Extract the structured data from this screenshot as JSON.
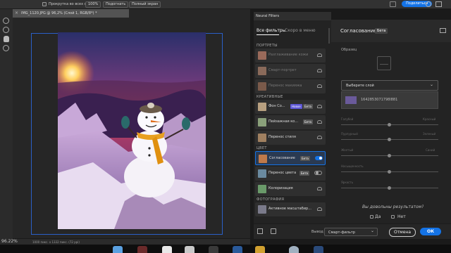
{
  "options_bar": {
    "scroll_all_label": "Прокрутка во всех окнах",
    "zoom_value": "100%",
    "fit_button": "Подогнать",
    "fullscreen_button": "Полный экран",
    "share_button": "Поделиться"
  },
  "document": {
    "tab_title": "IMG_1120.JPG @ 96,2% (Слой 1, RGB/8*) *",
    "zoom": "96.22%",
    "status": "1000 пикс. x 1332 пикс. (72 ppi)"
  },
  "neural_filters": {
    "panel_title": "Neural Filters",
    "tab_all": "Все фильтры",
    "tab_soon": "Скоро в меню",
    "sections": {
      "portraits": "ПОРТРЕТЫ",
      "creative": "КРЕАТИВНЫЕ",
      "color": "ЦВЕТ",
      "photo": "ФОТОГРАФИЯ"
    },
    "items": {
      "skin_smoothing": "Разглаживание кожи",
      "smart_portrait": "Смарт-портрет",
      "makeup_transfer": "Перенос макияжа",
      "background": "Фон Со...",
      "landscape": "Пейзажная ко...",
      "style_transfer": "Перенос стиля",
      "harmonization": "Согласование",
      "color_transfer": "Перенос цвета",
      "colorize": "Колоризация",
      "super_zoom": "Активное масштабир..."
    },
    "badges": {
      "new": "Новое",
      "beta": "Бета"
    }
  },
  "settings": {
    "title": "Согласование",
    "badge": "Бета",
    "sample_label": "Образец",
    "layer_select": "Выберите слой",
    "layer_option": "1642853071798l881",
    "sliders": [
      {
        "left": "Голубой",
        "right": "Красный",
        "value": 0.5
      },
      {
        "left": "Пурпурный",
        "right": "Зеленый",
        "value": 0.5
      },
      {
        "left": "Желтый",
        "right": "Синий",
        "value": 0.5
      },
      {
        "left": "Насыщенность",
        "value": 0.5
      },
      {
        "left": "Яркость",
        "value": 0.5
      }
    ],
    "feedback_question": "Вы довольны результатом?",
    "yes": "Да",
    "no": "Нет"
  },
  "bottom": {
    "output_label": "Вывод",
    "output_value": "Смарт-фильтр",
    "cancel": "Отмена",
    "ok": "ОК"
  },
  "colors": {
    "accent": "#1473e6",
    "new_badge": "#5e57d6",
    "panel": "#232323"
  }
}
